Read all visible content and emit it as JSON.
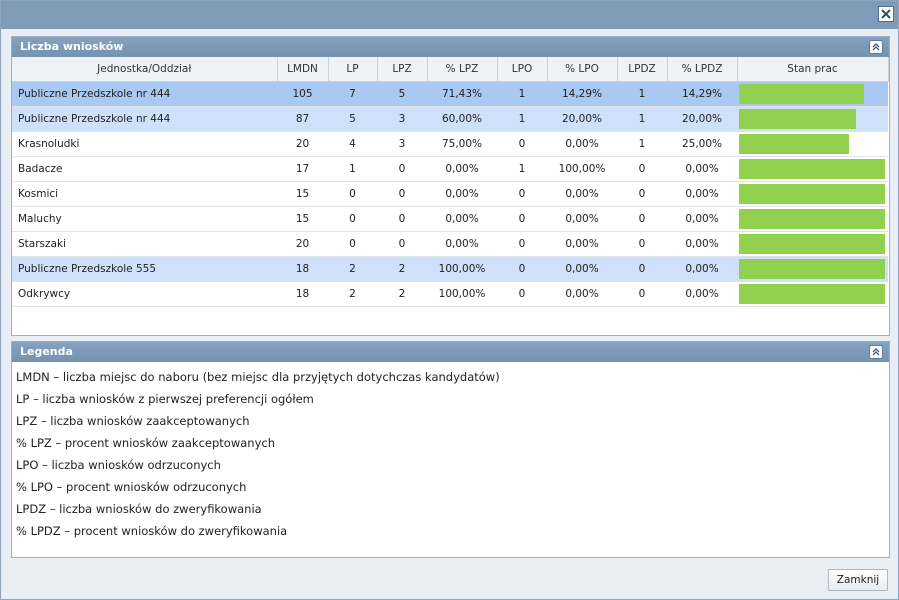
{
  "window": {
    "close_icon": "close-icon"
  },
  "applications_panel": {
    "title": "Liczba wniosków",
    "columns": [
      "Jednostka/Oddział",
      "LMDN",
      "LP",
      "LPZ",
      "% LPZ",
      "LPO",
      "% LPO",
      "LPDZ",
      "% LPDZ",
      "Stan prac"
    ],
    "rows": [
      {
        "name": "Publiczne Przedszkole nr 444",
        "lmdn": "105",
        "lp": "7",
        "lpz": "5",
        "pct_lpz": "71,43%",
        "lpo": "1",
        "pct_lpo": "14,29%",
        "lpdz": "1",
        "pct_lpdz": "14,29%",
        "progress": 0.857
      },
      {
        "name": "Publiczne Przedszkole nr 444",
        "lmdn": "87",
        "lp": "5",
        "lpz": "3",
        "pct_lpz": "60,00%",
        "lpo": "1",
        "pct_lpo": "20,00%",
        "lpdz": "1",
        "pct_lpdz": "20,00%",
        "progress": 0.8
      },
      {
        "name": "Krasnoludki",
        "lmdn": "20",
        "lp": "4",
        "lpz": "3",
        "pct_lpz": "75,00%",
        "lpo": "0",
        "pct_lpo": "0,00%",
        "lpdz": "1",
        "pct_lpdz": "25,00%",
        "progress": 0.75
      },
      {
        "name": "Badacze",
        "lmdn": "17",
        "lp": "1",
        "lpz": "0",
        "pct_lpz": "0,00%",
        "lpo": "1",
        "pct_lpo": "100,00%",
        "lpdz": "0",
        "pct_lpdz": "0,00%",
        "progress": 1.0
      },
      {
        "name": "Kosmici",
        "lmdn": "15",
        "lp": "0",
        "lpz": "0",
        "pct_lpz": "0,00%",
        "lpo": "0",
        "pct_lpo": "0,00%",
        "lpdz": "0",
        "pct_lpdz": "0,00%",
        "progress": 1.0
      },
      {
        "name": "Maluchy",
        "lmdn": "15",
        "lp": "0",
        "lpz": "0",
        "pct_lpz": "0,00%",
        "lpo": "0",
        "pct_lpo": "0,00%",
        "lpdz": "0",
        "pct_lpdz": "0,00%",
        "progress": 1.0
      },
      {
        "name": "Starszaki",
        "lmdn": "20",
        "lp": "0",
        "lpz": "0",
        "pct_lpz": "0,00%",
        "lpo": "0",
        "pct_lpo": "0,00%",
        "lpdz": "0",
        "pct_lpdz": "0,00%",
        "progress": 1.0
      },
      {
        "name": "Publiczne Przedszkole 555",
        "lmdn": "18",
        "lp": "2",
        "lpz": "2",
        "pct_lpz": "100,00%",
        "lpo": "0",
        "pct_lpo": "0,00%",
        "lpdz": "0",
        "pct_lpdz": "0,00%",
        "progress": 1.0
      },
      {
        "name": "Odkrywcy",
        "lmdn": "18",
        "lp": "2",
        "lpz": "2",
        "pct_lpz": "100,00%",
        "lpo": "0",
        "pct_lpo": "0,00%",
        "lpdz": "0",
        "pct_lpdz": "0,00%",
        "progress": 1.0
      }
    ],
    "progress_color": "#92d050",
    "row_highlights": [
      "dark",
      "light",
      "",
      "",
      "",
      "",
      "",
      "light",
      ""
    ]
  },
  "legend_panel": {
    "title": "Legenda",
    "lines": [
      "LMDN – liczba miejsc do naboru (bez miejsc dla przyjętych dotychczas kandydatów)",
      "LP – liczba wniosków z pierwszej preferencji ogółem",
      "LPZ – liczba wniosków zaakceptowanych",
      "% LPZ – procent wniosków zaakceptowanych",
      "LPO – liczba wniosków odrzuconych",
      "% LPO – procent wniosków odrzuconych",
      "LPDZ – liczba wniosków do zweryfikowania",
      "% LPDZ – procent wniosków do zweryfikowania"
    ]
  },
  "footer": {
    "close_label": "Zamknij"
  }
}
